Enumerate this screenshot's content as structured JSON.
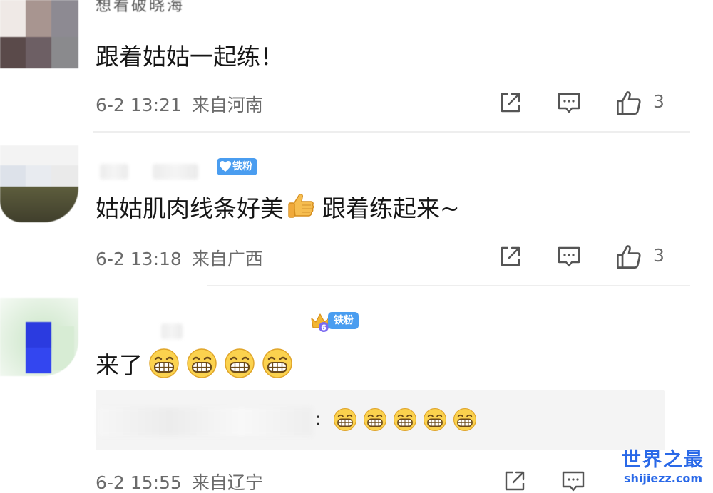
{
  "comments": [
    {
      "username": "想看破晓海",
      "content": "跟着姑姑一起练！",
      "date": "6-2 13:21",
      "location": "来自河南",
      "like_count": "3"
    },
    {
      "badge": "铁粉",
      "content": "姑姑肌肉线条好美",
      "content_emoji": "thumbs-up-emoji",
      "content_tail": "跟着练起来~",
      "date": "6-2 13:18",
      "location": "来自广西",
      "like_count": "3"
    },
    {
      "badge": "铁粉",
      "badge_level": "6",
      "content": "来了",
      "content_emoji": "grinning-face-emoji",
      "content_emoji_count": 4,
      "reply": {
        "separator": ":",
        "emoji": "grinning-face-emoji",
        "emoji_count": 5
      },
      "date": "6-2 15:55",
      "location": "来自辽宁"
    }
  ],
  "icons": {
    "share": "share-icon",
    "comment": "comment-icon",
    "like": "thumbs-up-icon"
  },
  "watermark": {
    "main": "世界之最",
    "sub": "shijiezz.com"
  },
  "colors": {
    "badge_blue": "#4a9df0",
    "watermark_blue": "#2a69e8",
    "meta_gray": "#6b6b6b"
  }
}
